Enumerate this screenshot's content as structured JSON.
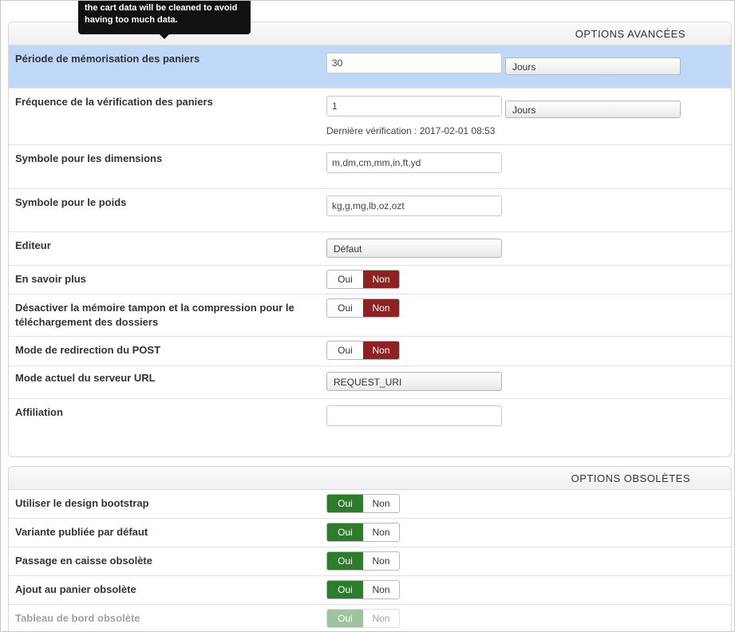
{
  "tooltip": {
    "line1": "the cart data will be cleaned to avoid",
    "line2": "having too much data."
  },
  "advanced": {
    "title": "OPTIONS AVANCÉES",
    "cart_period": {
      "label": "Période de mémorisation des paniers",
      "value": "30",
      "unit": "Jours"
    },
    "cart_check": {
      "label": "Fréquence de la vérification des paniers",
      "value": "1",
      "unit": "Jours",
      "last_check": "Dernière vérification : 2017-02-01 08:53"
    },
    "dimension_symbols": {
      "label": "Symbole pour les dimensions",
      "value": "m,dm,cm,mm,in,ft,yd"
    },
    "weight_symbols": {
      "label": "Symbole pour le poids",
      "value": "kg,g,mg,lb,oz,ozt"
    },
    "editor": {
      "label": "Editeur",
      "value": "Défaut"
    },
    "learn_more": {
      "label": "En savoir plus",
      "yes": "Oui",
      "no": "Non"
    },
    "disable_buffer": {
      "label": "Désactiver la mémoire tampon et la compression pour le téléchargement des dossiers",
      "yes": "Oui",
      "no": "Non"
    },
    "post_redirect": {
      "label": "Mode de redirection du POST",
      "yes": "Oui",
      "no": "Non"
    },
    "server_url": {
      "label": "Mode actuel du serveur URL",
      "value": "REQUEST_URI"
    },
    "affiliation": {
      "label": "Affiliation",
      "value": ""
    }
  },
  "obsolete": {
    "title": "OPTIONS OBSOLÈTES",
    "bootstrap": {
      "label": "Utiliser le design bootstrap",
      "yes": "Oui",
      "no": "Non"
    },
    "default_variant": {
      "label": "Variante publiée par défaut",
      "yes": "Oui",
      "no": "Non"
    },
    "old_checkout": {
      "label": "Passage en caisse obsolète",
      "yes": "Oui",
      "no": "Non"
    },
    "old_add_to_cart": {
      "label": "Ajout au panier obsolète",
      "yes": "Oui",
      "no": "Non"
    },
    "old_dashboard": {
      "label": "Tableau de bord obsolète",
      "yes": "Oui",
      "no": "Non"
    }
  },
  "colors": {
    "no_active": "#8e2121",
    "yes_active": "#2c7c2c",
    "highlight": "#bfd8f8"
  }
}
